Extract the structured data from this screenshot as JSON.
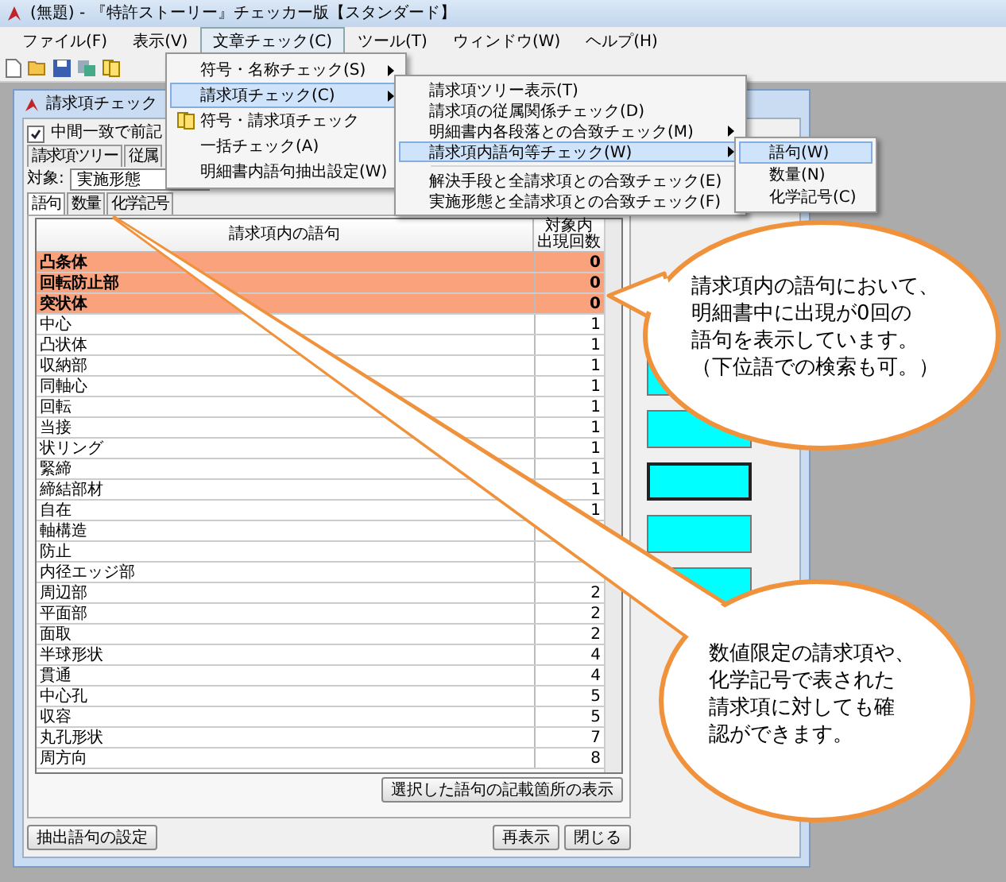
{
  "window": {
    "title": "(無題) - 『特許ストーリー』チェッカー版【スタンダード】"
  },
  "menu_bar": [
    {
      "label": "ファイル(F)",
      "selected": false
    },
    {
      "label": "表示(V)",
      "selected": false
    },
    {
      "label": "文章チェック(C)",
      "selected": true
    },
    {
      "label": "ツール(T)",
      "selected": false
    },
    {
      "label": "ウィンドウ(W)",
      "selected": false
    },
    {
      "label": "ヘルプ(H)",
      "selected": false
    }
  ],
  "check_menu": [
    {
      "kind": "item",
      "label": "符号・名称チェック(S)",
      "has_submenu": true,
      "selected": false
    },
    {
      "kind": "item",
      "label": "請求項チェック(C)",
      "has_submenu": true,
      "selected": true
    },
    {
      "kind": "icon_item",
      "label": "符号・請求項チェック",
      "has_submenu": false,
      "selected": false
    },
    {
      "kind": "item",
      "label": "一括チェック(A)",
      "has_submenu": false,
      "selected": false
    },
    {
      "kind": "item",
      "label": "明細書内語句抽出設定(W)",
      "has_submenu": false,
      "selected": false
    }
  ],
  "claim_submenu": [
    {
      "kind": "item",
      "label": "請求項ツリー表示(T)",
      "has_submenu": false,
      "selected": false
    },
    {
      "kind": "item",
      "label": "請求項の従属関係チェック(D)",
      "has_submenu": false,
      "selected": false
    },
    {
      "kind": "item",
      "label": "明細書内各段落との合致チェック(M)",
      "has_submenu": true,
      "selected": false
    },
    {
      "kind": "item",
      "label": "請求項内語句等チェック(W)",
      "has_submenu": true,
      "selected": true
    },
    {
      "kind": "separator"
    },
    {
      "kind": "item",
      "label": "解決手段と全請求項との合致チェック(E)",
      "has_submenu": false,
      "selected": false
    },
    {
      "kind": "item",
      "label": "実施形態と全請求項との合致チェック(F)",
      "has_submenu": false,
      "selected": false
    }
  ],
  "terms_submenu": [
    {
      "kind": "item",
      "label": "語句(W)",
      "has_submenu": false,
      "selected": true
    },
    {
      "kind": "item",
      "label": "数量(N)",
      "has_submenu": false,
      "selected": false
    },
    {
      "kind": "item",
      "label": "化学記号(C)",
      "has_submenu": false,
      "selected": false
    }
  ],
  "child_window": {
    "title": "請求項チェック",
    "match_option": {
      "label": "中間一致で前記",
      "checked": true
    },
    "tabs": [
      {
        "label": "請求項ツリー",
        "selected": false
      },
      {
        "label": "従属",
        "selected": false
      }
    ],
    "target": {
      "label": "対象:",
      "value": "実施形態"
    },
    "subtabs": [
      {
        "label": "語句",
        "selected": true
      },
      {
        "label": "数量",
        "selected": false
      },
      {
        "label": "化学記号",
        "selected": false
      }
    ],
    "table": {
      "columns": [
        {
          "lines": [
            "請求項内の語句"
          ]
        },
        {
          "lines": [
            "対象内",
            "出現回数"
          ]
        }
      ],
      "rows": [
        {
          "term": "凸条体",
          "count": "0",
          "highlighted": true
        },
        {
          "term": "回転防止部",
          "count": "0",
          "highlighted": true
        },
        {
          "term": "突状体",
          "count": "0",
          "highlighted": true
        },
        {
          "term": "中心",
          "count": "1",
          "highlighted": false
        },
        {
          "term": "凸状体",
          "count": "1",
          "highlighted": false
        },
        {
          "term": "収納部",
          "count": "1",
          "highlighted": false
        },
        {
          "term": "同軸心",
          "count": "1",
          "highlighted": false
        },
        {
          "term": "回転",
          "count": "1",
          "highlighted": false
        },
        {
          "term": "当接",
          "count": "1",
          "highlighted": false
        },
        {
          "term": "状リング",
          "count": "1",
          "highlighted": false
        },
        {
          "term": "緊締",
          "count": "1",
          "highlighted": false
        },
        {
          "term": "締結部材",
          "count": "1",
          "highlighted": false
        },
        {
          "term": "自在",
          "count": "1",
          "highlighted": false
        },
        {
          "term": "軸構造",
          "highlighted": false
        },
        {
          "term": "防止",
          "highlighted": false
        },
        {
          "term": "内径エッジ部",
          "highlighted": false
        },
        {
          "term": "周辺部",
          "count": "2",
          "highlighted": false
        },
        {
          "term": "平面部",
          "count": "2",
          "highlighted": false
        },
        {
          "term": "面取",
          "count": "2",
          "highlighted": false
        },
        {
          "term": "半球形状",
          "count": "4",
          "highlighted": false
        },
        {
          "term": "貫通",
          "count": "4",
          "highlighted": false
        },
        {
          "term": "中心孔",
          "count": "5",
          "highlighted": false
        },
        {
          "term": "収容",
          "count": "5",
          "highlighted": false
        },
        {
          "term": "丸孔形状",
          "count": "7",
          "highlighted": false
        },
        {
          "term": "周方向",
          "count": "8",
          "highlighted": false
        }
      ]
    },
    "show_location_button": "選択した語句の記載箇所の表示",
    "buttons_left": [
      "抽出語句の設定"
    ],
    "buttons_right": [
      "再表示",
      "閉じる"
    ],
    "side_bars": [
      {
        "selected": false
      },
      {
        "selected": false
      },
      {
        "selected": true
      },
      {
        "selected": false
      },
      {
        "selected": false
      }
    ]
  },
  "callouts": [
    {
      "lines": [
        "請求項内の語句において、",
        "明細書中に出現が0回の",
        "語句を表示しています。",
        "（下位語での検索も可。）"
      ]
    },
    {
      "lines": [
        "数値限定の請求項や、",
        "化学記号で表された",
        "請求項に対しても確",
        "認ができます。"
      ]
    }
  ]
}
